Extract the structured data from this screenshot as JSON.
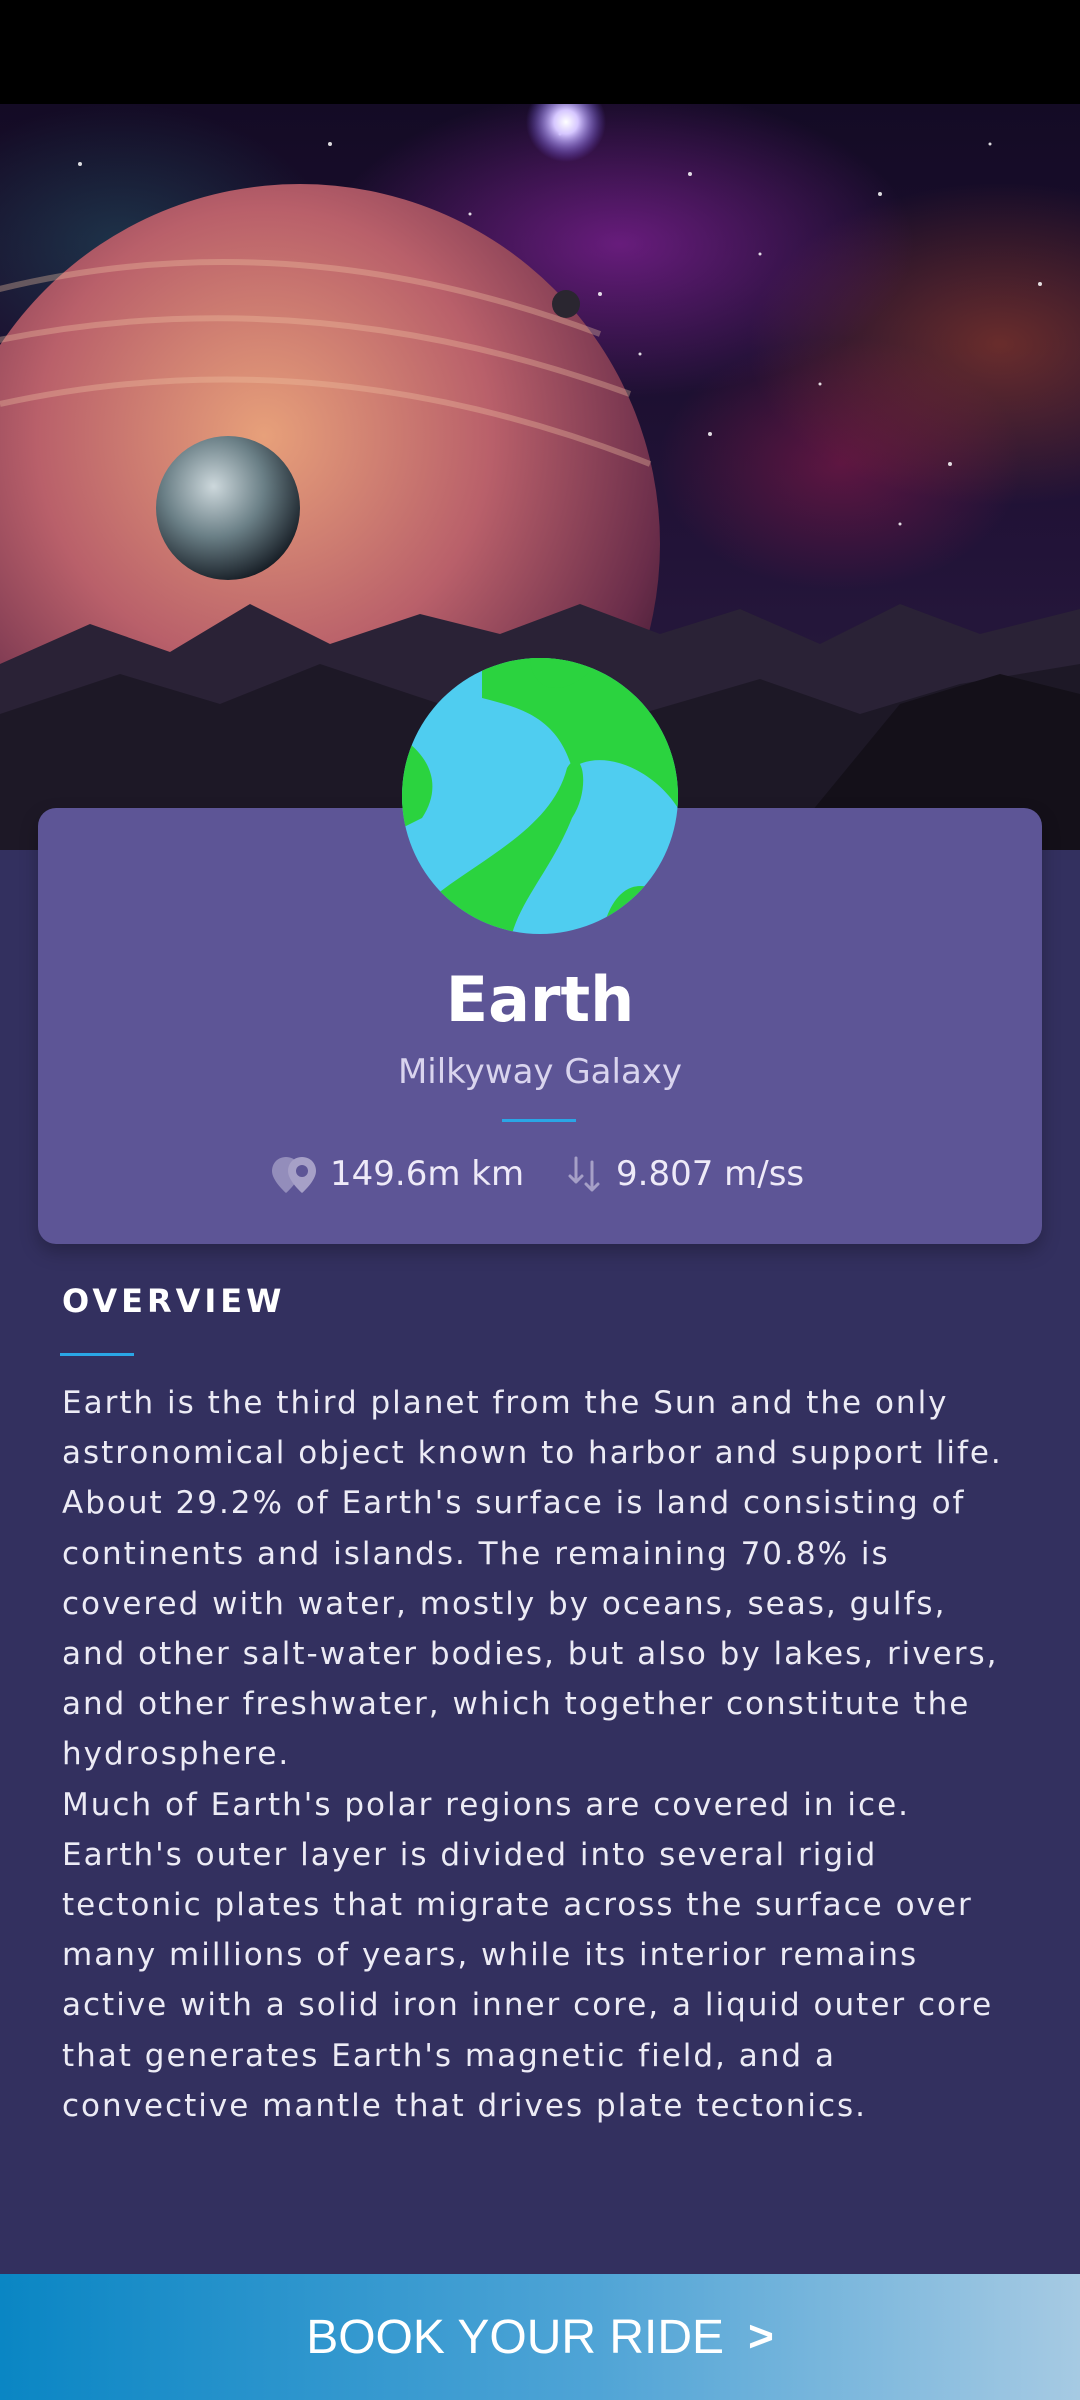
{
  "planet": {
    "name": "Earth",
    "galaxy": "Milkyway Galaxy",
    "distance": "149.6m km",
    "gravity": "9.807 m/ss",
    "icon": "earth-globe-icon"
  },
  "overview": {
    "title": "OVERVIEW",
    "text": "Earth is the third planet from the Sun and the only astronomical object known to harbor and support life. About 29.2% of Earth's surface is land consisting of continents and islands. The remaining 70.8% is covered with water, mostly by oceans, seas, gulfs, and other salt-water bodies, but also by lakes, rivers, and other freshwater, which together constitute the hydrosphere.\n Much of Earth's polar regions are covered in ice. Earth's outer layer is divided into several rigid tectonic plates that migrate across the surface over many millions of years, while its interior remains active with a solid iron inner core, a liquid outer core that generates Earth's magnetic field, and a convective mantle that drives plate tectonics."
  },
  "cta": {
    "label": "BOOK YOUR RIDE",
    "chevron": ">"
  },
  "colors": {
    "background": "#33305f",
    "card": "#5d5596",
    "accent": "#2aa6e6",
    "earth_land": "#2bd33f",
    "earth_water": "#4fcdf0"
  }
}
